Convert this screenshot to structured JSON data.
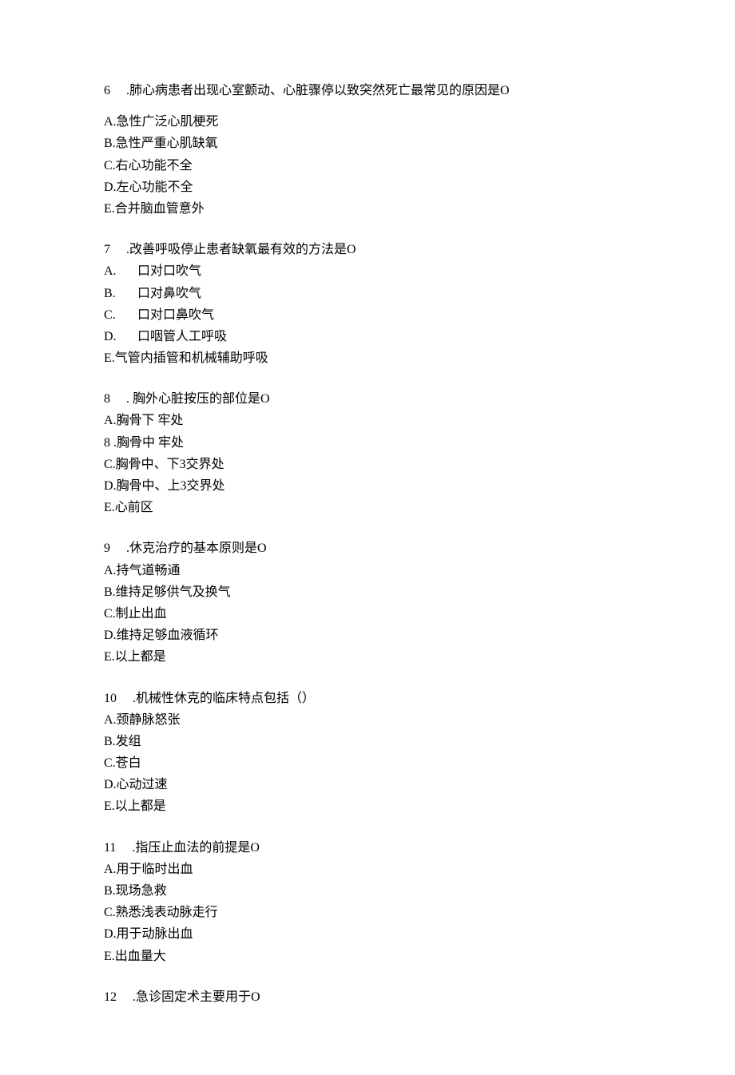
{
  "questions": [
    {
      "num": "6",
      "text": ".肺心病患者出现心室颤动、心脏骤停以致突然死亡最常见的原因是O",
      "options": [
        {
          "label": "A.急性广泛心肌梗死"
        },
        {
          "label": "B.急性严重心肌缺氧"
        },
        {
          "label": "C.右心功能不全"
        },
        {
          "label": "D.左心功能不全"
        },
        {
          "label": "E.合并脑血管意外"
        }
      ]
    },
    {
      "num": "7",
      "text": ".改善呼吸停止患者缺氧最有效的方法是O",
      "options": [
        {
          "letter": "A.",
          "label": "口对口吹气",
          "indent": true
        },
        {
          "letter": "B.",
          "label": "口对鼻吹气",
          "indent": true
        },
        {
          "letter": "C.",
          "label": "口对口鼻吹气",
          "indent": true
        },
        {
          "letter": "D.",
          "label": "口咽管人工呼吸",
          "indent": true
        },
        {
          "label": "E.气管内插管和机械辅助呼吸"
        }
      ]
    },
    {
      "num": "8",
      "text": ". 胸外心脏按压的部位是O",
      "options": [
        {
          "label": "A.胸骨下 牢处"
        },
        {
          "label": "8   .胸骨中 牢处"
        },
        {
          "label": "C.胸骨中、下3交界处"
        },
        {
          "label": "D.胸骨中、上3交界处"
        },
        {
          "label": "E.心前区"
        }
      ]
    },
    {
      "num": "9",
      "text": ".休克治疗的基本原则是O",
      "options": [
        {
          "label": "A.持气道畅通"
        },
        {
          "label": "B.维持足够供气及换气"
        },
        {
          "label": "C.制止出血"
        },
        {
          "label": "D.维持足够血液循环"
        },
        {
          "label": "E.以上都是"
        }
      ]
    },
    {
      "num": "10",
      "text": ".机械性休克的临床特点包括（）",
      "options": [
        {
          "label": "A.颈静脉怒张"
        },
        {
          "label": "B.发组"
        },
        {
          "label": "C.苍白"
        },
        {
          "label": "D.心动过速"
        },
        {
          "label": "E.以上都是"
        }
      ]
    },
    {
      "num": "11",
      "text": ".指压止血法的前提是O",
      "options": [
        {
          "label": "A.用于临时出血"
        },
        {
          "label": "B.现场急救"
        },
        {
          "label": "C.熟悉浅表动脉走行"
        },
        {
          "label": "D.用于动脉出血"
        },
        {
          "label": "E.出血量大"
        }
      ]
    },
    {
      "num": "12",
      "text": ".急诊固定术主要用于O",
      "options": []
    }
  ]
}
